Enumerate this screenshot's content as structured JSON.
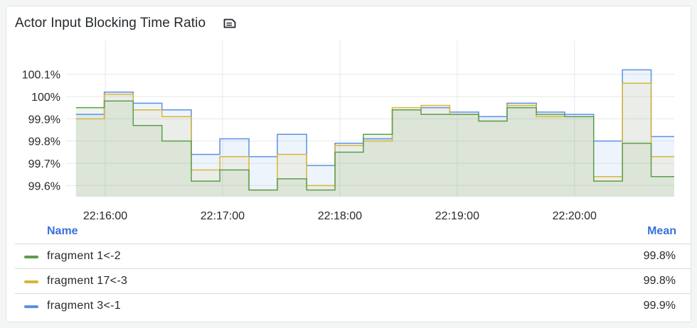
{
  "panel": {
    "title": "Actor Input Blocking Time Ratio",
    "description_icon": "document-icon"
  },
  "legend": {
    "name_header": "Name",
    "mean_header": "Mean",
    "rows": [
      {
        "name": "fragment 1<-2",
        "mean": "99.8%",
        "color": "#5b9e4d"
      },
      {
        "name": "fragment 17<-3",
        "mean": "99.8%",
        "color": "#d6b63a"
      },
      {
        "name": "fragment 3<-1",
        "mean": "99.9%",
        "color": "#5d8fe6"
      }
    ]
  },
  "chart_data": {
    "type": "line",
    "step": true,
    "y_unit": "%",
    "ylim": [
      99.55,
      100.15
    ],
    "y_ticks": [
      {
        "value": 100.1,
        "label": "100.1%"
      },
      {
        "value": 100.0,
        "label": "100%"
      },
      {
        "value": 99.9,
        "label": "99.9%"
      },
      {
        "value": 99.8,
        "label": "99.8%"
      },
      {
        "value": 99.7,
        "label": "99.7%"
      },
      {
        "value": 99.6,
        "label": "99.6%"
      }
    ],
    "x_range_seconds": [
      -20,
      291
    ],
    "x_ticks": [
      {
        "t": 0,
        "label": "22:16:00"
      },
      {
        "t": 60,
        "label": "22:17:00"
      },
      {
        "t": 120,
        "label": "22:18:00"
      },
      {
        "t": 180,
        "label": "22:19:00"
      },
      {
        "t": 240,
        "label": "22:20:00"
      }
    ],
    "x_grid_t": [
      -30,
      0,
      60,
      120,
      180,
      240
    ],
    "grid": true,
    "x": [
      -15,
      -0.5,
      14.3,
      29,
      44,
      58.6,
      73.5,
      88,
      103,
      117.5,
      132,
      146.8,
      161.5,
      176.2,
      191,
      205.5,
      220.5,
      235,
      249.8,
      264.5,
      279.2,
      291
    ],
    "series": [
      {
        "name": "fragment 1<-2",
        "color": "#5b9e4d",
        "values": [
          99.95,
          99.98,
          99.87,
          99.8,
          99.62,
          99.67,
          99.58,
          99.63,
          99.58,
          99.75,
          99.83,
          99.94,
          99.92,
          99.92,
          99.89,
          99.95,
          99.92,
          99.91,
          99.62,
          99.79,
          99.64,
          99.64
        ]
      },
      {
        "name": "fragment 17<-3",
        "color": "#d6b63a",
        "values": [
          99.9,
          100.01,
          99.94,
          99.91,
          99.67,
          99.73,
          99.58,
          99.74,
          99.6,
          99.78,
          99.8,
          99.95,
          99.96,
          99.92,
          99.89,
          99.96,
          99.91,
          99.91,
          99.64,
          100.06,
          99.73,
          99.73
        ]
      },
      {
        "name": "fragment 3<-1",
        "color": "#5d8fe6",
        "values": [
          99.92,
          100.02,
          99.97,
          99.94,
          99.74,
          99.81,
          99.73,
          99.83,
          99.69,
          99.79,
          99.81,
          99.94,
          99.95,
          99.93,
          99.91,
          99.97,
          99.93,
          99.92,
          99.8,
          100.12,
          99.82,
          99.82
        ]
      }
    ]
  }
}
